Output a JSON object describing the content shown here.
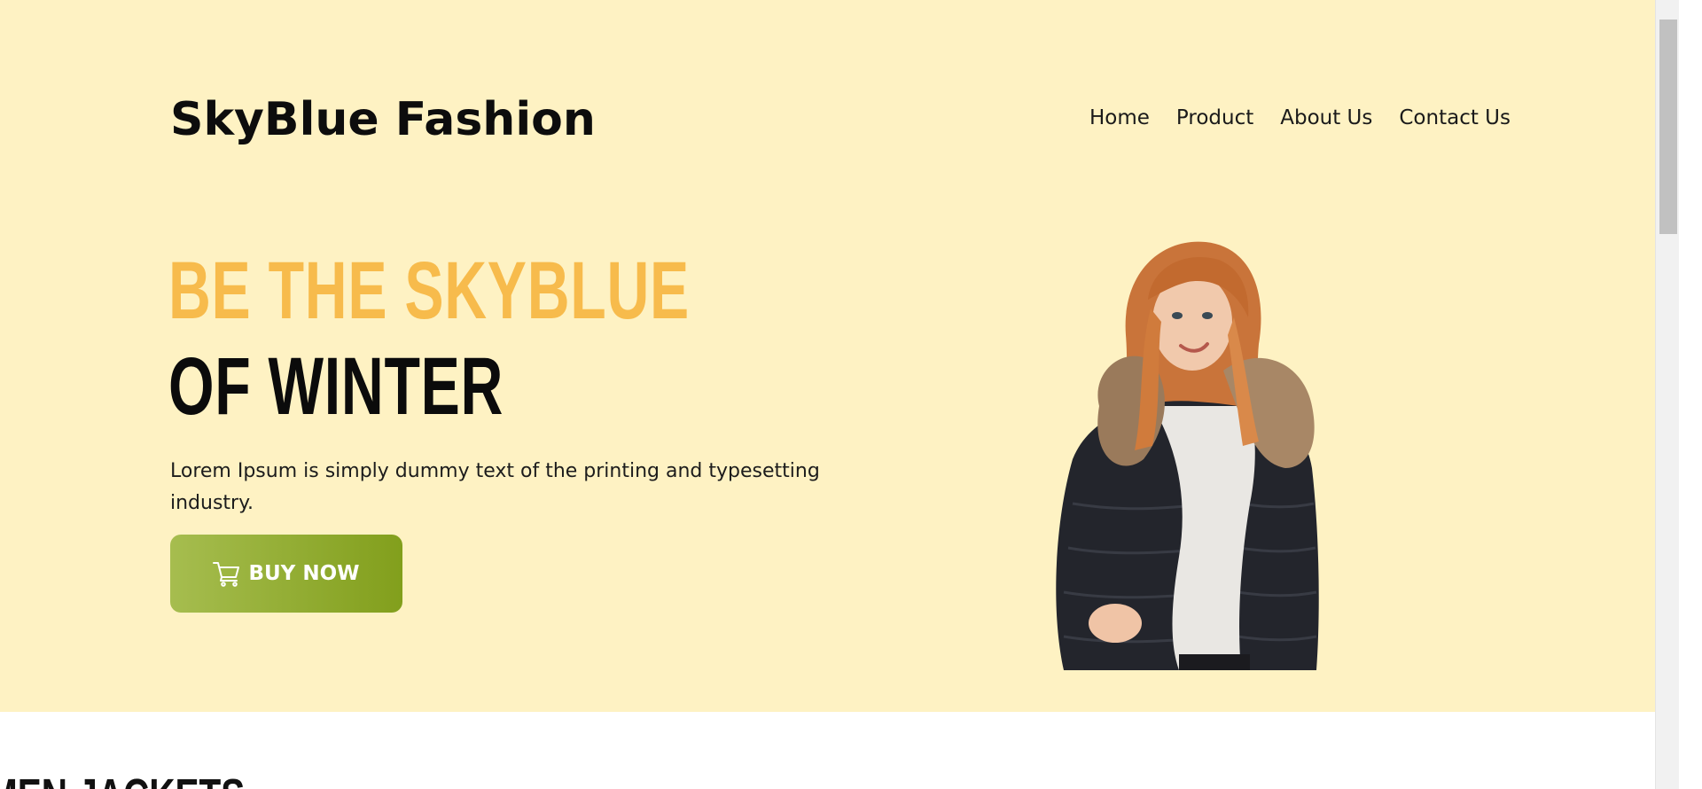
{
  "brand": "SkyBlue Fashion",
  "nav": {
    "items": [
      "Home",
      "Product",
      "About Us",
      "Contact Us"
    ]
  },
  "hero": {
    "headline_line1": "BE THE SKYBLUE",
    "headline_line2": "OF WINTER",
    "description": "Lorem Ipsum is simply dummy text of the printing and typesetting industry.",
    "button_label": "BUY NOW",
    "button_icon": "cart-icon"
  },
  "section": {
    "title": "MEN JACKETS"
  },
  "colors": {
    "hero_bg": "#fef2c3",
    "accent_yellow": "#f7bb4c",
    "button_green_start": "#a6bd4f",
    "button_green_end": "#829f1c"
  }
}
